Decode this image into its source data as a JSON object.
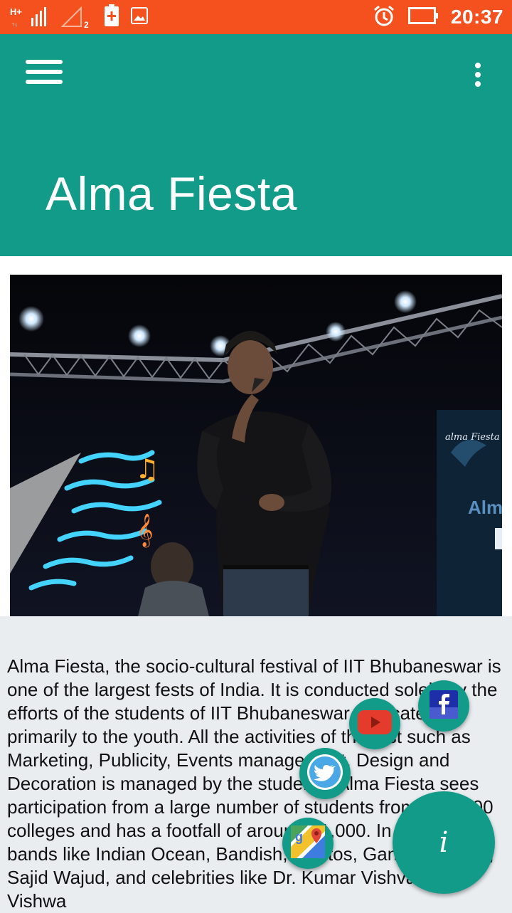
{
  "status_bar": {
    "network_type": "H+",
    "sim_badge": "2",
    "time": "20:37",
    "icons": [
      "signal-icon",
      "no-signal-icon",
      "battery-charging-icon",
      "image-icon",
      "alarm-icon",
      "battery-icon"
    ]
  },
  "app_bar": {
    "title": "Alma Fiesta",
    "menu_icon": "hamburger-menu-icon",
    "more_icon": "more-vertical-icon",
    "color": "#139b8a"
  },
  "hero_image": {
    "banner_text": "alma Fiesta"
  },
  "description": " Alma Fiesta, the socio-cultural festival of IIT Bhubaneswar is one of the largest fests of India. It is conducted solely by the efforts of the students of IIT Bhubaneswar and caters primarily to the youth. All the activities of the fest such as Marketing, Publicity, Events management, Design and Decoration is managed by the students. Alma Fiesta sees participation from a large number of students from over 300 colleges and has a footfall of around 21,000. In the past, bands like Indian Ocean, Bandish, kryptos, Ganesh Talkies, Sajid Wajud, and celebrities like Dr. Kumar Vishvas,Pt. Vishwa",
  "social_fabs": [
    {
      "name": "facebook",
      "icon": "facebook-icon"
    },
    {
      "name": "youtube",
      "icon": "youtube-icon"
    },
    {
      "name": "twitter",
      "icon": "twitter-icon"
    },
    {
      "name": "maps",
      "icon": "google-maps-icon"
    }
  ],
  "info_fab": {
    "label": "i",
    "icon": "info-icon"
  },
  "colors": {
    "status_bar": "#f4511e",
    "accent": "#139b8a",
    "background": "#e9edf0"
  }
}
